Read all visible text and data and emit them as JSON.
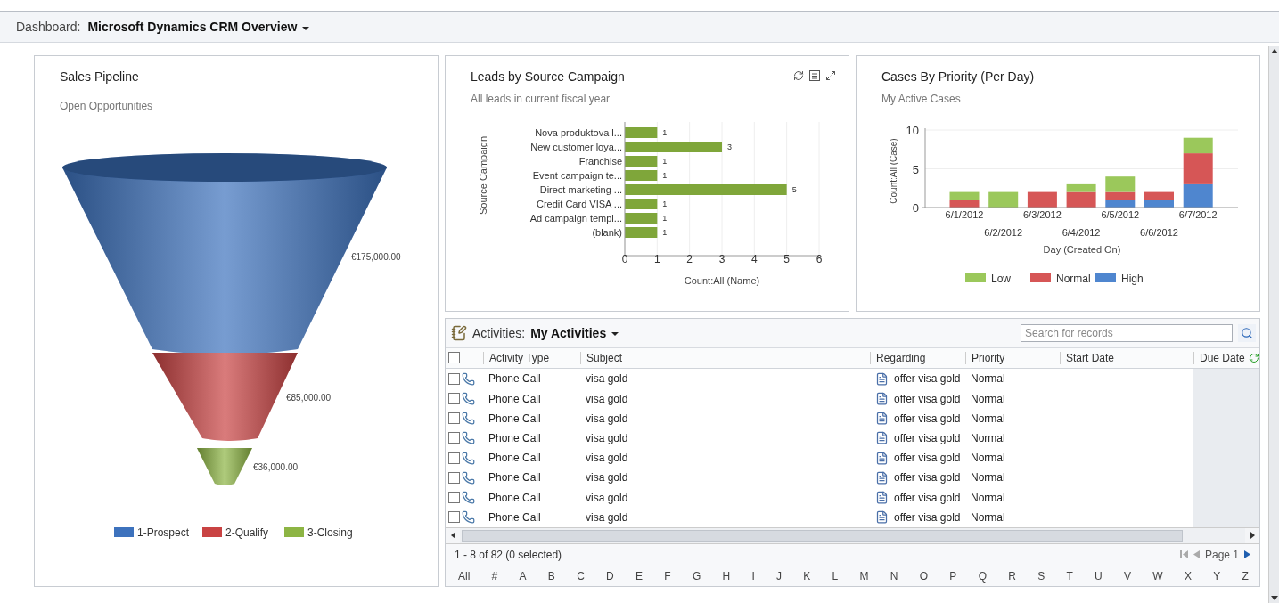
{
  "header": {
    "label": "Dashboard:",
    "title": "Microsoft Dynamics CRM Overview"
  },
  "sales_pipeline": {
    "title": "Sales Pipeline",
    "subtitle": "Open Opportunities",
    "stages": [
      {
        "name": "1-Prospect",
        "value": "€175,000.00",
        "color": "#3d72bd"
      },
      {
        "name": "2-Qualify",
        "value": "€85,000.00",
        "color": "#c94343"
      },
      {
        "name": "3-Closing",
        "value": "€36,000.00",
        "color": "#8db544"
      }
    ]
  },
  "leads_chart": {
    "title": "Leads by Source Campaign",
    "subtitle": "All leads in current fiscal year",
    "chart_data": {
      "type": "bar",
      "orientation": "horizontal",
      "xlabel": "Count:All (Name)",
      "ylabel": "Source Campaign",
      "categories": [
        "Nova produktova l...",
        "New customer loya...",
        "Franchise",
        "Event campaign te...",
        "Direct marketing ...",
        "Credit Card VISA ...",
        "Ad campaign templ...",
        "(blank)"
      ],
      "values": [
        1,
        3,
        1,
        1,
        5,
        1,
        1,
        1
      ],
      "xlim": [
        0,
        6
      ],
      "xticks": [
        0,
        1,
        2,
        3,
        4,
        5,
        6
      ],
      "grid": true,
      "data_labels": true
    }
  },
  "cases_chart": {
    "title": "Cases By Priority (Per Day)",
    "subtitle": "My Active Cases",
    "chart_data": {
      "type": "bar",
      "stacked": true,
      "xlabel": "Day (Created On)",
      "ylabel": "Count:All (Case)",
      "categories": [
        "6/1/2012",
        "6/2/2012",
        "6/3/2012",
        "6/4/2012",
        "6/5/2012",
        "6/6/2012",
        "6/7/2012"
      ],
      "ylim": [
        0,
        10
      ],
      "yticks": [
        0,
        5,
        10
      ],
      "grid": true,
      "legend": true,
      "series": [
        {
          "name": "Low",
          "color": "#9bc85b",
          "values": [
            1,
            2,
            0,
            1,
            2,
            0,
            2
          ]
        },
        {
          "name": "Normal",
          "color": "#d65656",
          "values": [
            1,
            0,
            2,
            2,
            1,
            1,
            4
          ]
        },
        {
          "name": "High",
          "color": "#4f86cf",
          "values": [
            0,
            0,
            0,
            0,
            1,
            1,
            3
          ]
        }
      ]
    }
  },
  "activities": {
    "label": "Activities:",
    "view": "My Activities",
    "search": {
      "placeholder": "Search for records"
    },
    "columns": [
      "Activity Type",
      "Subject",
      "Regarding",
      "Priority",
      "Start Date",
      "Due Date"
    ],
    "select_all": {
      "checked": false
    },
    "rows": [
      {
        "checked": false,
        "activity_type": "Phone Call",
        "subject": "visa gold",
        "regarding": "offer visa gold",
        "priority": "Normal"
      },
      {
        "checked": false,
        "activity_type": "Phone Call",
        "subject": "visa gold",
        "regarding": "offer visa gold",
        "priority": "Normal"
      },
      {
        "checked": false,
        "activity_type": "Phone Call",
        "subject": "visa gold",
        "regarding": "offer visa gold",
        "priority": "Normal"
      },
      {
        "checked": false,
        "activity_type": "Phone Call",
        "subject": "visa gold",
        "regarding": "offer visa gold",
        "priority": "Normal"
      },
      {
        "checked": false,
        "activity_type": "Phone Call",
        "subject": "visa gold",
        "regarding": "offer visa gold",
        "priority": "Normal"
      },
      {
        "checked": false,
        "activity_type": "Phone Call",
        "subject": "visa gold",
        "regarding": "offer visa gold",
        "priority": "Normal"
      },
      {
        "checked": false,
        "activity_type": "Phone Call",
        "subject": "visa gold",
        "regarding": "offer visa gold",
        "priority": "Normal"
      },
      {
        "checked": false,
        "activity_type": "Phone Call",
        "subject": "visa gold",
        "regarding": "offer visa gold",
        "priority": "Normal"
      }
    ],
    "record_count": "1 - 8 of 82 (0 selected)",
    "page": "Page 1",
    "letters": [
      "All",
      "#",
      "A",
      "B",
      "C",
      "D",
      "E",
      "F",
      "G",
      "H",
      "I",
      "J",
      "K",
      "L",
      "M",
      "N",
      "O",
      "P",
      "Q",
      "R",
      "S",
      "T",
      "U",
      "V",
      "W",
      "X",
      "Y",
      "Z"
    ]
  }
}
